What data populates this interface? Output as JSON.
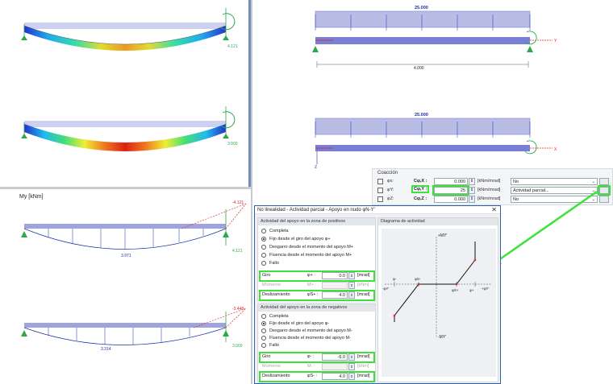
{
  "left_top": {
    "end_labels": [
      "4.121",
      "3.000"
    ]
  },
  "my_panel": {
    "title": "My [kNm]",
    "beam1": {
      "left_value": "-4.121",
      "right_value": "4.121",
      "mid_value": "3.971"
    },
    "beam2": {
      "left_value": "-3.448",
      "right_value": "3.000",
      "mid_value": "3.314"
    }
  },
  "right_top": {
    "load1": "25.000",
    "load2": "25.000",
    "span": "4.000",
    "axis_labels": {
      "x": "X",
      "y": "Y",
      "z": "Z"
    }
  },
  "coupling": {
    "title": "Coacción",
    "rows": [
      {
        "sym": "φx:",
        "label": "Cφ,X :",
        "value": "0.000",
        "unit": "[kNm/mrad]",
        "select": "No",
        "checked": false,
        "highlight": false
      },
      {
        "sym": "φY:",
        "label": "Cφ,Y :",
        "value": "25",
        "unit": "[kNm/mrad]",
        "select": "Actividad parcial...",
        "checked": false,
        "highlight": true
      },
      {
        "sym": "φZ:",
        "label": "Cφ,Z :",
        "value": "0.000",
        "unit": "[kNm/mrad]",
        "select": "No",
        "checked": false,
        "highlight": false
      }
    ]
  },
  "dialog": {
    "title": "No linealidad - Actividad parcial - Apoyo en nudo φN-Y'",
    "positive": {
      "header": "Actividad del apoyo en la zona de positivos",
      "options": [
        "Completa",
        "Fijo desde el giro del apoyo φ+",
        "Desgarro desde el momento del apoyo M+",
        "Fluencia desde el momento del apoyo M+",
        "Fallo"
      ],
      "selected": 1,
      "fields": [
        {
          "label": "Giro",
          "sym": "φ+ :",
          "value": "0.0",
          "unit": "[mrad]",
          "disabled": false
        },
        {
          "label": "Momento",
          "sym": "M+ :",
          "value": "",
          "unit": "[kNm]",
          "disabled": true
        },
        {
          "label": "Deslizamiento",
          "sym": "φS+ :",
          "value": "4.0",
          "unit": "[mrad]",
          "disabled": false
        }
      ]
    },
    "negative": {
      "header": "Actividad del apoyo en la zona de negativos",
      "options": [
        "Completa",
        "Fijo desde el giro del apoyo φ-",
        "Desgarro desde el momento del apoyo M-",
        "Fluencia desde el momento del apoyo M-",
        "Fallo"
      ],
      "selected": 1,
      "fields": [
        {
          "label": "Giro",
          "sym": "φ- :",
          "value": "-6.0",
          "unit": "[mrad]",
          "disabled": false
        },
        {
          "label": "Momento",
          "sym": "M- :",
          "value": "",
          "unit": "[kNm]",
          "disabled": true
        },
        {
          "label": "Deslizamiento",
          "sym": "φS- :",
          "value": "4.0",
          "unit": "[mrad]",
          "disabled": false
        }
      ]
    },
    "diagram": {
      "header": "Diagrama de actividad",
      "axis_top": "+MY'",
      "axis_bottom": "-MY'",
      "left_end": "-φY'",
      "right_end": "+φY'",
      "phi_minus": "φ-",
      "phi_s_minus": "φS-",
      "phi_s_plus": "φS+",
      "phi_plus": "φ+"
    }
  },
  "colors": {
    "beam": "#7a7fd6",
    "highlight": "#3ee03e",
    "support": "#2ea84a",
    "moment": "#1a2fa8"
  }
}
